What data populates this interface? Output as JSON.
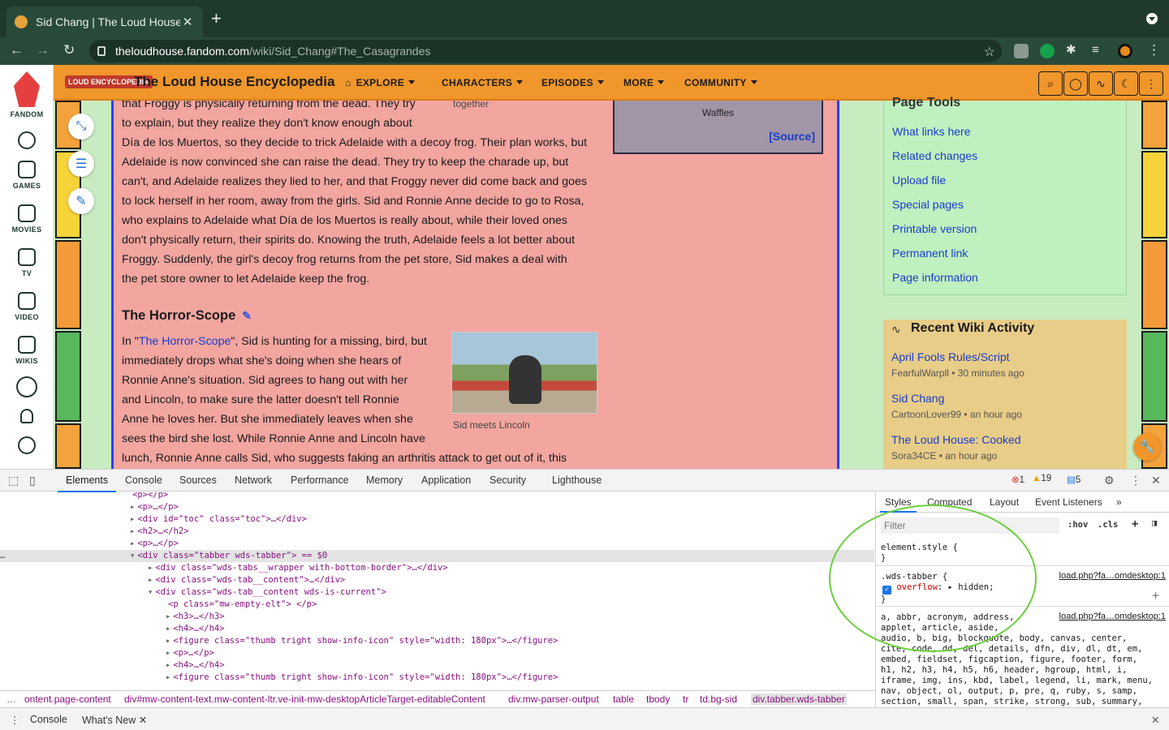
{
  "browser": {
    "tab_title": "Sid Chang | The Loud House E",
    "url_domain": "theloudhouse.fandom.com",
    "url_path": "/wiki/Sid_Chang#The_Casagrandes"
  },
  "rail": {
    "brand": "FANDOM",
    "items": [
      "GAMES",
      "MOVIES",
      "TV",
      "VIDEO",
      "WIKIS"
    ]
  },
  "wiki": {
    "logo": "LOUD ENCYCLOPEDIA",
    "title": "The Loud House Encyclopedia",
    "nav": [
      "EXPLORE",
      "CHARACTERS",
      "EPISODES",
      "MORE",
      "COMMUNITY"
    ]
  },
  "article": {
    "caption_top": "together",
    "infobox_waffles": "Waffles",
    "infobox_source": "[Source]",
    "para1": [
      "that Froggy is physically returning from the dead. They try",
      "to explain, but they realize they don't know enough about",
      "Día de los Muertos, so they decide to trick Adelaide with a decoy frog. Their plan works, but",
      "Adelaide is now convinced she can raise the dead. They try to keep the charade up, but",
      "can't, and Adelaide realizes they lied to her, and that Froggy never did come back and goes",
      "to lock herself in her room, away from the girls. Sid and Ronnie Anne decide to go to Rosa,",
      "who explains to Adelaide what Día de los Muertos is really about, while their loved ones",
      "don't physically return, their spirits do. Knowing the truth, Adelaide feels a lot better about",
      "Froggy. Suddenly, the girl's decoy frog returns from the pet store, Sid makes a deal with",
      "the pet store owner to let Adelaide keep the frog."
    ],
    "heading": "The Horror-Scope",
    "para2_prefix": "In \"",
    "para2_link": "The Horror-Scope",
    "para2_suffix": "\", Sid is hunting for a missing, bird, but",
    "para2": [
      "immediately drops what she's doing when she hears of",
      "Ronnie Anne's situation. Sid agrees to hang out with her",
      "and Lincoln, to make sure the latter doesn't tell Ronnie",
      "Anne he loves her. But she immediately leaves when she",
      "sees the bird she lost. While Ronnie Anne and Lincoln have",
      "lunch, Ronnie Anne calls Sid, who suggests faking an arthritis attack to get out of it, this"
    ],
    "thumb_caption": "Sid meets Lincoln"
  },
  "page_tools": {
    "title": "Page Tools",
    "links": [
      "What links here",
      "Related changes",
      "Upload file",
      "Special pages",
      "Printable version",
      "Permanent link",
      "Page information"
    ]
  },
  "activity": {
    "title": "Recent Wiki Activity",
    "items": [
      {
        "title": "April Fools Rules/Script",
        "meta": "FearfulWarpll • 30 minutes ago"
      },
      {
        "title": "Sid Chang",
        "meta": "CartoonLover99 • an hour ago"
      },
      {
        "title": "The Loud House: Cooked",
        "meta": "Sora34CE • an hour ago"
      }
    ]
  },
  "devtools": {
    "tabs": [
      "Elements",
      "Console",
      "Sources",
      "Network",
      "Performance",
      "Memory",
      "Application",
      "Security",
      "Lighthouse"
    ],
    "errors": "1",
    "warnings": "19",
    "messages": "5",
    "dom_lines": [
      {
        "indent": 14,
        "text": "<p></p>"
      },
      {
        "indent": 14,
        "text": "<p>…</p>"
      },
      {
        "indent": 14,
        "text": "<div id=\"toc\" class=\"toc\">…</div>"
      },
      {
        "indent": 14,
        "text": "<h2>…</h2>"
      },
      {
        "indent": 14,
        "text": "<p>…</p>"
      },
      {
        "indent": 14,
        "text": "<div class=\"tabber wds-tabber\"> == $0"
      },
      {
        "indent": 16,
        "text": "<div class=\"wds-tabs__wrapper with-bottom-border\">…</div>"
      },
      {
        "indent": 16,
        "text": "<div class=\"wds-tab__content\">…</div>"
      },
      {
        "indent": 16,
        "text": "<div class=\"wds-tab__content wds-is-current\">"
      },
      {
        "indent": 18,
        "text": "<p class=\"mw-empty-elt\"> </p>"
      },
      {
        "indent": 18,
        "text": "<h3>…</h3>"
      },
      {
        "indent": 18,
        "text": "<h4>…</h4>"
      },
      {
        "indent": 18,
        "text": "<figure class=\"thumb tright show-info-icon\" style=\"width: 180px\">…</figure>"
      },
      {
        "indent": 18,
        "text": "<p>…</p>"
      },
      {
        "indent": 18,
        "text": "<h4>…</h4>"
      },
      {
        "indent": 18,
        "text": "<figure class=\"thumb tright show-info-icon\" style=\"width: 180px\">…</figure>"
      }
    ],
    "breadcrumbs": [
      "ontent.page-content",
      "div#mw-content-text.mw-content-ltr.ve-init-mw-desktopArticleTarget-editableContent",
      "div.mw-parser-output",
      "table",
      "tbody",
      "tr",
      "td.bg-sid",
      "div.tabber.wds-tabber"
    ],
    "styles_tabs": [
      "Styles",
      "Computed",
      "Layout",
      "Event Listeners"
    ],
    "filter_placeholder": "Filter",
    "hov": ":hov",
    "cls": ".cls",
    "element_style": "element.style {",
    "rule_selector": ".wds-tabber {",
    "rule_prop": "overflow",
    "rule_val": "hidden;",
    "rule_source": "load.php?fa…omdesktop:1",
    "reset_source": "load.php?fa…omdesktop:1",
    "reset_lines": [
      "a, abbr, acronym, address,",
      "applet, article, aside,",
      "audio, b, big, blockquote, body, canvas, center,",
      "cite, code, dd, del, details, dfn, div, dl, dt, em,",
      "embed, fieldset, figcaption, figure, footer, form,",
      "h1, h2, h3, h4, h5, h6, header, hgroup, html, i,",
      "iframe, img, ins, kbd, label, legend, li, mark, menu,",
      "nav, object, ol, output, p, pre, q, ruby, s, samp,",
      "section, small, span, strike, strong, sub, summary,"
    ],
    "drawer_tabs": [
      "Console",
      "What's New"
    ]
  }
}
